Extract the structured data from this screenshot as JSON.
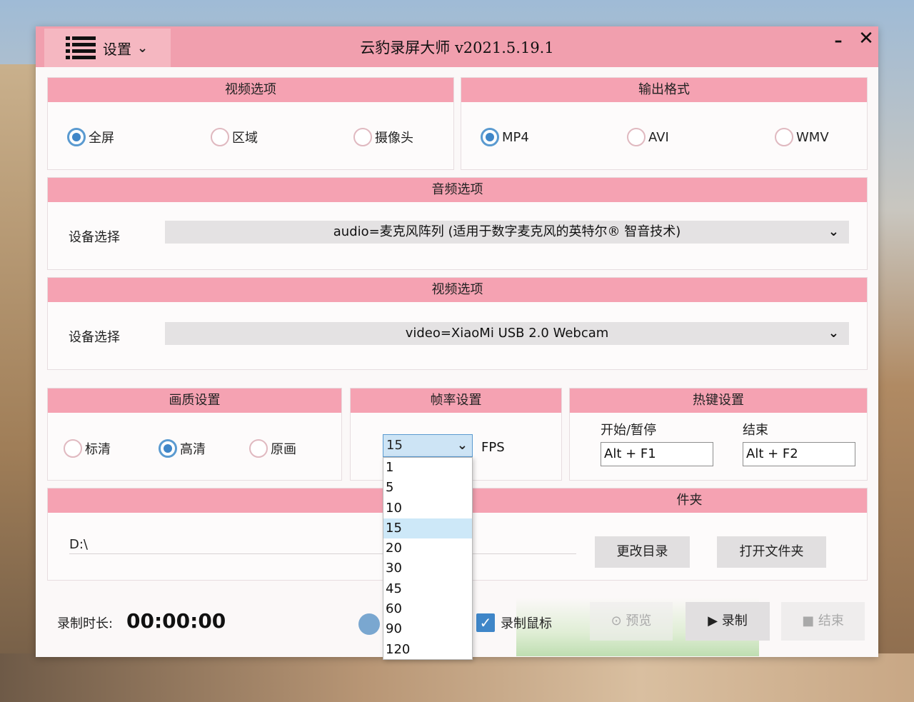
{
  "window": {
    "title": "云豹录屏大师  v2021.5.19.1",
    "menu_label": "设置",
    "minimize": "–",
    "close": "✕"
  },
  "video_options": {
    "title": "视频选项",
    "radios": [
      {
        "label": "全屏",
        "checked": true
      },
      {
        "label": "区域",
        "checked": false
      },
      {
        "label": "摄像头",
        "checked": false
      }
    ]
  },
  "output_format": {
    "title": "输出格式",
    "radios": [
      {
        "label": "MP4",
        "checked": true
      },
      {
        "label": "AVI",
        "checked": false
      },
      {
        "label": "WMV",
        "checked": false
      }
    ]
  },
  "audio_options": {
    "title": "音频选项",
    "device_label": "设备选择",
    "device_value": "audio=麦克风阵列 (适用于数字麦克风的英特尔® 智音技术)"
  },
  "video_device": {
    "title": "视频选项",
    "device_label": "设备选择",
    "device_value": "video=XiaoMi USB 2.0 Webcam"
  },
  "quality": {
    "title": "画质设置",
    "radios": [
      {
        "label": "标清",
        "checked": false
      },
      {
        "label": "高清",
        "checked": true
      },
      {
        "label": "原画",
        "checked": false
      }
    ]
  },
  "framerate": {
    "title": "帧率设置",
    "selected": "15",
    "unit": "FPS",
    "options": [
      "1",
      "5",
      "10",
      "15",
      "20",
      "30",
      "45",
      "60",
      "90",
      "120"
    ]
  },
  "hotkeys": {
    "title": "热键设置",
    "start_label": "开始/暂停",
    "start_value": "Alt + F1",
    "end_label": "结束",
    "end_value": "Alt + F2"
  },
  "output_folder": {
    "title_visible": "件夹",
    "path": "D:\\",
    "change_button": "更改目录",
    "open_button": "打开文件夹"
  },
  "footer": {
    "duration_label": "录制时长:",
    "duration_value": "00:00:00",
    "record_mouse_label": "录制鼠标",
    "record_mouse_checked": true,
    "preview_button": "预览",
    "record_button": "录制",
    "stop_button": "结束"
  },
  "colors": {
    "accent_pink": "#f5a2b2",
    "title_pink": "#f19fae",
    "radio_blue": "#3f86c8"
  }
}
